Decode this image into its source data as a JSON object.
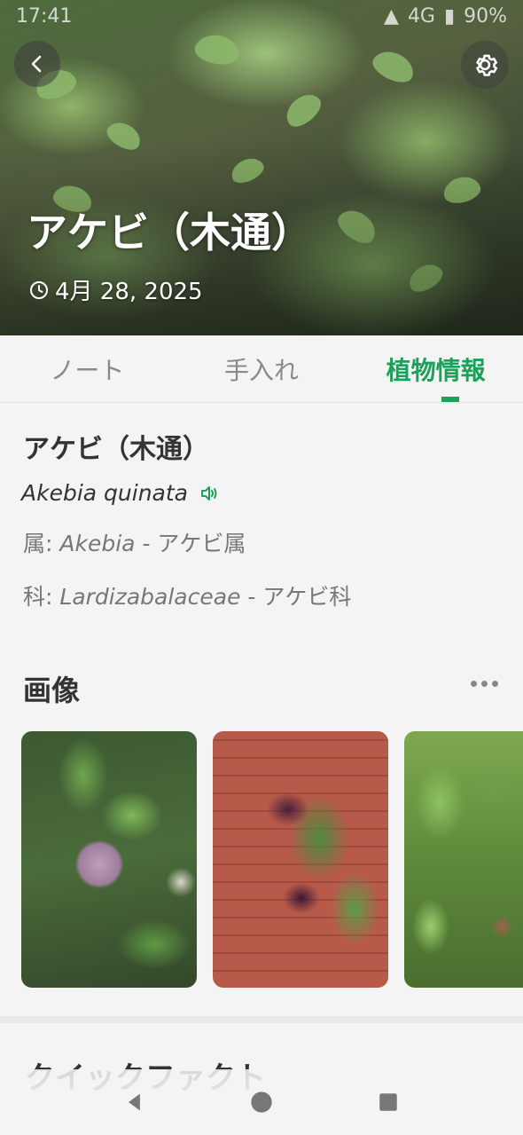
{
  "status_bar": {
    "time": "17:41",
    "network": "4G",
    "battery": "90%"
  },
  "header": {
    "back_icon": "chevron-left-icon",
    "settings_icon": "gear-icon",
    "title": "アケビ（木通）",
    "date": "4月 28, 2025",
    "date_icon": "clock-icon"
  },
  "tabs": [
    {
      "label": "ノート",
      "active": false
    },
    {
      "label": "手入れ",
      "active": false
    },
    {
      "label": "植物情報",
      "active": true
    }
  ],
  "info": {
    "common_name": "アケビ（木通）",
    "scientific_name": "Akebia quinata",
    "audio_icon": "speaker-icon",
    "genus": {
      "label": "属:",
      "latin": "Akebia",
      "separator": " - ",
      "local": "アケビ属"
    },
    "family": {
      "label": "科:",
      "latin": "Lardizabalaceae",
      "separator": " - ",
      "local": "アケビ科"
    }
  },
  "images": {
    "title": "画像",
    "more_icon": "more-horizontal-icon"
  },
  "quick_facts": {
    "title": "クイックファクト"
  },
  "navbar": {
    "back_icon": "triangle-back-icon",
    "home_icon": "circle-home-icon",
    "recents_icon": "square-recents-icon"
  },
  "colors": {
    "accent": "#1ea05a",
    "background": "#f4f4f4"
  }
}
